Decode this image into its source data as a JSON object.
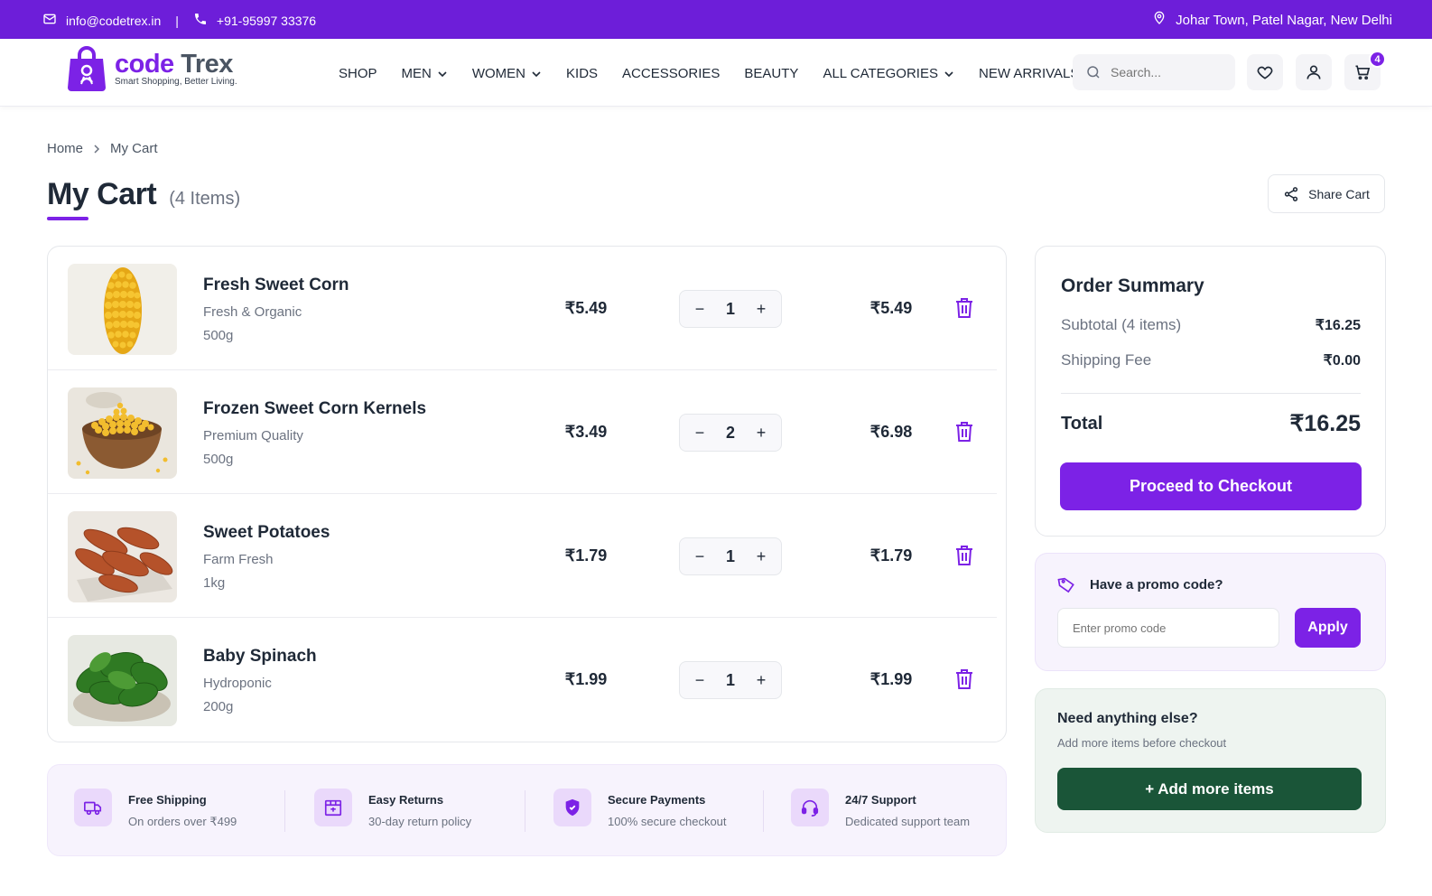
{
  "topbar": {
    "email": "info@codetrex.in",
    "separator": "|",
    "phone": "+91-95997 33376",
    "location": "Johar Town, Patel Nagar, New Delhi"
  },
  "brand": {
    "name_part1": "code",
    "name_part2": "Trex",
    "tagline": "Smart Shopping, Better Living.",
    "primary_color": "#7c22e6",
    "topbar_color": "#6d1ed9"
  },
  "nav": {
    "items": [
      {
        "label": "SHOP",
        "dropdown": false
      },
      {
        "label": "MEN",
        "dropdown": true
      },
      {
        "label": "WOMEN",
        "dropdown": true
      },
      {
        "label": "KIDS",
        "dropdown": false
      },
      {
        "label": "ACCESSORIES",
        "dropdown": false
      },
      {
        "label": "BEAUTY",
        "dropdown": false
      },
      {
        "label": "ALL CATEGORIES",
        "dropdown": true
      },
      {
        "label": "NEW ARRIVALS",
        "dropdown": false
      }
    ]
  },
  "search": {
    "placeholder": "Search..."
  },
  "cart_badge": "4",
  "breadcrumb": {
    "home": "Home",
    "current": "My Cart"
  },
  "page": {
    "title": "My Cart",
    "count_label": "(4 Items)",
    "share_label": "Share Cart"
  },
  "cart": {
    "items": [
      {
        "name": "Fresh Sweet Corn",
        "desc": "Fresh & Organic",
        "weight": "500g",
        "price": "₹5.49",
        "qty": "1",
        "total": "₹5.49",
        "image": "corn"
      },
      {
        "name": "Frozen Sweet Corn Kernels",
        "desc": "Premium Quality",
        "weight": "500g",
        "price": "₹3.49",
        "qty": "2",
        "total": "₹6.98",
        "image": "corn-kernels"
      },
      {
        "name": "Sweet Potatoes",
        "desc": "Farm Fresh",
        "weight": "1kg",
        "price": "₹1.79",
        "qty": "1",
        "total": "₹1.79",
        "image": "sweet-potatoes"
      },
      {
        "name": "Baby Spinach",
        "desc": "Hydroponic",
        "weight": "200g",
        "price": "₹1.99",
        "qty": "1",
        "total": "₹1.99",
        "image": "spinach"
      }
    ],
    "minus": "−",
    "plus": "+"
  },
  "features": [
    {
      "title": "Free Shipping",
      "sub": "On orders over ₹499",
      "icon": "truck-icon"
    },
    {
      "title": "Easy Returns",
      "sub": "30-day return policy",
      "icon": "box-icon"
    },
    {
      "title": "Secure Payments",
      "sub": "100% secure checkout",
      "icon": "shield-icon"
    },
    {
      "title": "24/7 Support",
      "sub": "Dedicated support team",
      "icon": "headset-icon"
    }
  ],
  "summary": {
    "title": "Order Summary",
    "subtotal_label": "Subtotal (4 items)",
    "subtotal_value": "₹16.25",
    "shipping_label": "Shipping Fee",
    "shipping_value": "₹0.00",
    "total_label": "Total",
    "total_value": "₹16.25",
    "checkout_label": "Proceed to Checkout"
  },
  "promo": {
    "title": "Have a promo code?",
    "placeholder": "Enter promo code",
    "apply_label": "Apply"
  },
  "need": {
    "title": "Need anything else?",
    "sub": "Add more items before checkout",
    "button_label": "+ Add more items",
    "button_color": "#1a5538"
  }
}
